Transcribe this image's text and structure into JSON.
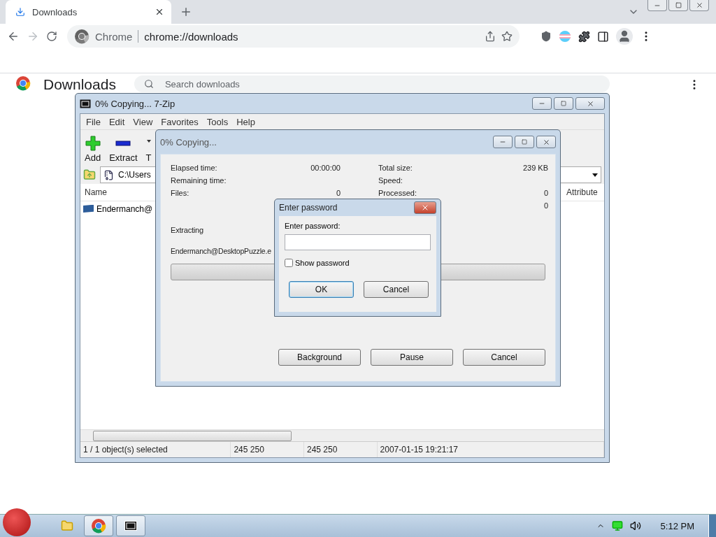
{
  "browser": {
    "tabs": [
      {
        "label": "Downloads",
        "selected": true
      }
    ],
    "address": {
      "site_label": "Chrome",
      "url": "chrome://downloads"
    }
  },
  "page": {
    "title": "Downloads",
    "search": {
      "placeholder": "Search downloads"
    }
  },
  "archive_window": {
    "title": "0% Copying... 7-Zip",
    "menu": [
      "File",
      "Edit",
      "View",
      "Favorites",
      "Tools",
      "Help"
    ],
    "toolbar": [
      {
        "label": "Add",
        "kind": "add"
      },
      {
        "label": "Extract",
        "kind": "extract"
      },
      {
        "label": "T",
        "kind": "test"
      }
    ],
    "path": "C:\\Users",
    "columns": [
      "Name",
      "Attribute"
    ],
    "rows": [
      {
        "name": "Endermanch@"
      }
    ],
    "status": [
      "1 / 1 object(s) selected",
      "245 250",
      "245 250",
      "2007-01-15 19:21:17"
    ]
  },
  "progress_dialog": {
    "title": "0% Copying...",
    "stats_left": [
      {
        "label": "Elapsed time:",
        "value": "00:00:00"
      },
      {
        "label": "Remaining time:"
      },
      {
        "label": "Files:",
        "value": "0"
      }
    ],
    "stats_right": [
      {
        "label": "Total size:",
        "value": "239 KB"
      },
      {
        "label": "Speed:"
      },
      {
        "label": "Processed:",
        "value": "0"
      },
      {
        "value": "0"
      }
    ],
    "action": "Extracting",
    "file": "Endermanch@DesktopPuzzle.e",
    "level": 0,
    "buttons": [
      "Background",
      "Pause",
      "Cancel"
    ]
  },
  "password_dialog": {
    "title": "Enter password",
    "label": "Enter password:",
    "show_password": {
      "label": "Show password",
      "checked": false
    },
    "buttons": [
      {
        "label": "OK",
        "focused": true
      },
      {
        "label": "Cancel",
        "focused": false
      }
    ]
  },
  "taskbar": {
    "apps": [
      {
        "kind": "explorer"
      },
      {
        "kind": "chrome",
        "active": true
      },
      {
        "kind": "archiver",
        "active": true
      }
    ],
    "clock": "5:12 PM"
  }
}
